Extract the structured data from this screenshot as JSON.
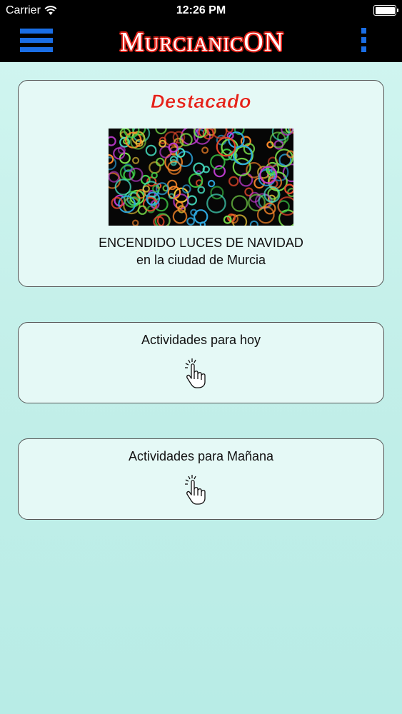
{
  "status_bar": {
    "carrier": "Carrier",
    "time": "12:26 PM"
  },
  "nav": {
    "logo_text": "MurcianicON",
    "accent_color": "#1a6ee6",
    "logo_color": "#e2231a"
  },
  "featured": {
    "heading": "Destacado",
    "title_line1": "ENCENDIDO LUCES DE NAVIDAD",
    "title_line2": "en la ciudad de Murcia"
  },
  "buttons": {
    "today_label": "Actividades para hoy",
    "tomorrow_label": "Actividades para Mañana"
  }
}
